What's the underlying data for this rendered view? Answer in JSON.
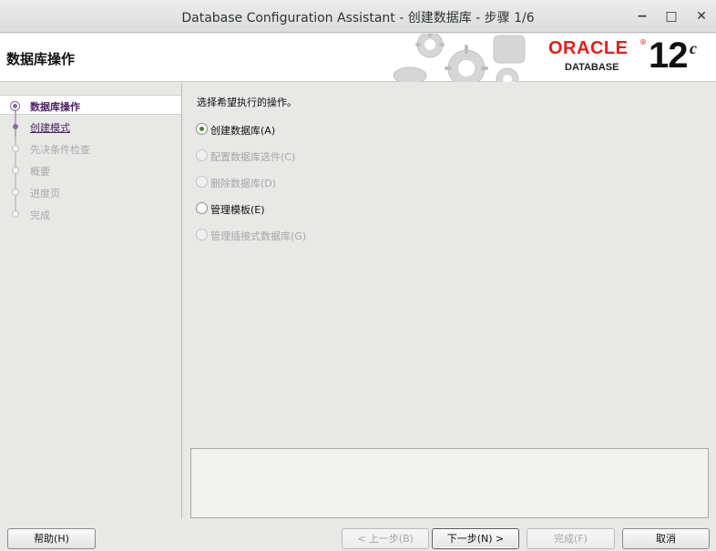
{
  "window": {
    "title": "Database Configuration Assistant - 创建数据库 - 步骤 1/6",
    "minimize_glyph": "−",
    "maximize_glyph": "□",
    "close_glyph": "✕"
  },
  "banner": {
    "heading": "数据库操作",
    "logo_word": "ORACLE",
    "logo_reg": "®",
    "logo_sub": "DATABASE",
    "version": "12",
    "version_sup": "c"
  },
  "steps": [
    {
      "label": "数据库操作",
      "state": "current"
    },
    {
      "label": "创建模式",
      "state": "link"
    },
    {
      "label": "先决条件检查",
      "state": "disabled"
    },
    {
      "label": "概要",
      "state": "disabled"
    },
    {
      "label": "进度页",
      "state": "disabled"
    },
    {
      "label": "完成",
      "state": "disabled"
    }
  ],
  "content": {
    "prompt": "选择希望执行的操作。",
    "options": [
      {
        "label": "创建数据库(A)",
        "checked": true,
        "enabled": true
      },
      {
        "label": "配置数据库选件(C)",
        "checked": false,
        "enabled": false
      },
      {
        "label": "删除数据库(D)",
        "checked": false,
        "enabled": false
      },
      {
        "label": "管理模板(E)",
        "checked": false,
        "enabled": true
      },
      {
        "label": "管理插接式数据库(G)",
        "checked": false,
        "enabled": false
      }
    ]
  },
  "buttons": {
    "help": "帮助(H)",
    "back": "< 上一步(B)",
    "next": "下一步(N) >",
    "finish": "完成(F)",
    "cancel": "取消"
  },
  "colors": {
    "oracle_red": "#e0201b",
    "step_accent": "#4a1f63",
    "radio_checked": "#4b7f2f"
  }
}
